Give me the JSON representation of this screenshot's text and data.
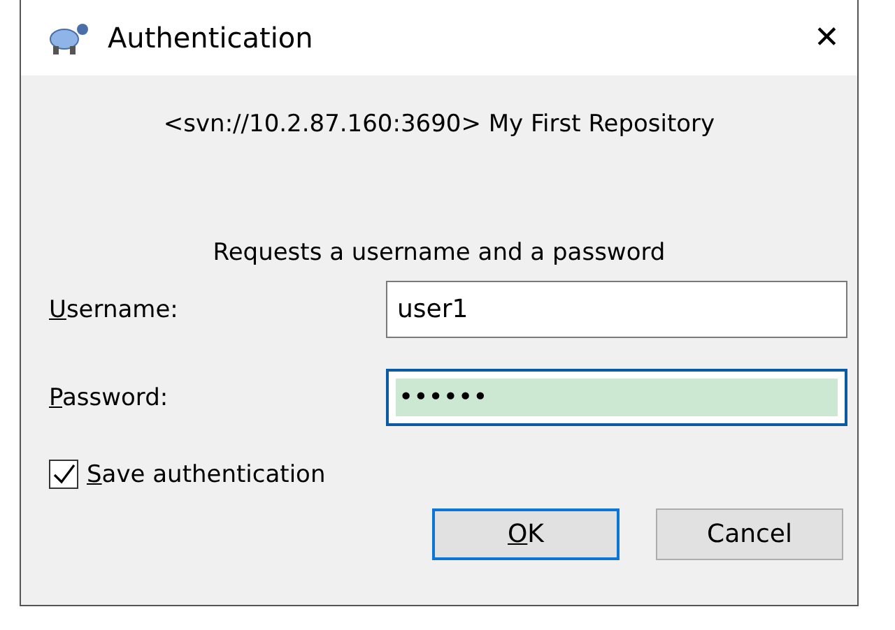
{
  "window": {
    "title": "Authentication",
    "close": "✕"
  },
  "realm": "<svn://10.2.87.160:3690> My First Repository",
  "prompt": "Requests a username and a password",
  "fields": [
    {
      "label": "Username:",
      "mnemonic": true,
      "value": "user1",
      "focused": false,
      "highlighted": false
    },
    {
      "label": "Password:",
      "mnemonic": true,
      "value": "••••••",
      "focused": true,
      "highlighted": true
    }
  ],
  "save_authentication": {
    "label": "Save authentication",
    "mnemonic": true,
    "checked": true
  },
  "buttons": [
    {
      "label": "OK",
      "mnemonic": true,
      "default": true
    },
    {
      "label": "Cancel",
      "mnemonic": false,
      "default": false
    }
  ]
}
